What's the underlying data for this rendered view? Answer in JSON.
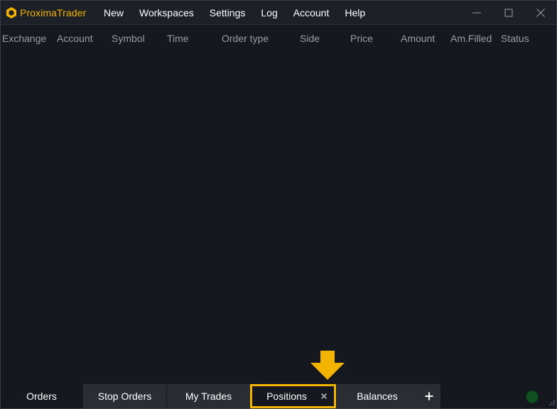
{
  "app": {
    "name": "ProximaTrader",
    "brand_color": "#f2b400"
  },
  "menu": {
    "items": [
      "New",
      "Workspaces",
      "Settings",
      "Log",
      "Account",
      "Help"
    ]
  },
  "window_controls": {
    "icons": [
      "minimize-icon",
      "maximize-icon",
      "close-icon"
    ]
  },
  "columns": [
    "Exchange",
    "Account",
    "Symbol",
    "Time",
    "Order type",
    "Side",
    "Price",
    "Amount",
    "Am.Filled",
    "Status"
  ],
  "tabs": [
    {
      "label": "Orders",
      "state": "active"
    },
    {
      "label": "Stop Orders",
      "state": "inactive"
    },
    {
      "label": "My Trades",
      "state": "inactive"
    },
    {
      "label": "Positions",
      "state": "highlighted"
    },
    {
      "label": "Balances",
      "state": "inactive"
    }
  ],
  "add_tab": {
    "label": "+"
  },
  "connection_status": {
    "color": "#0f5220"
  },
  "highlight_color": "#f2b400"
}
